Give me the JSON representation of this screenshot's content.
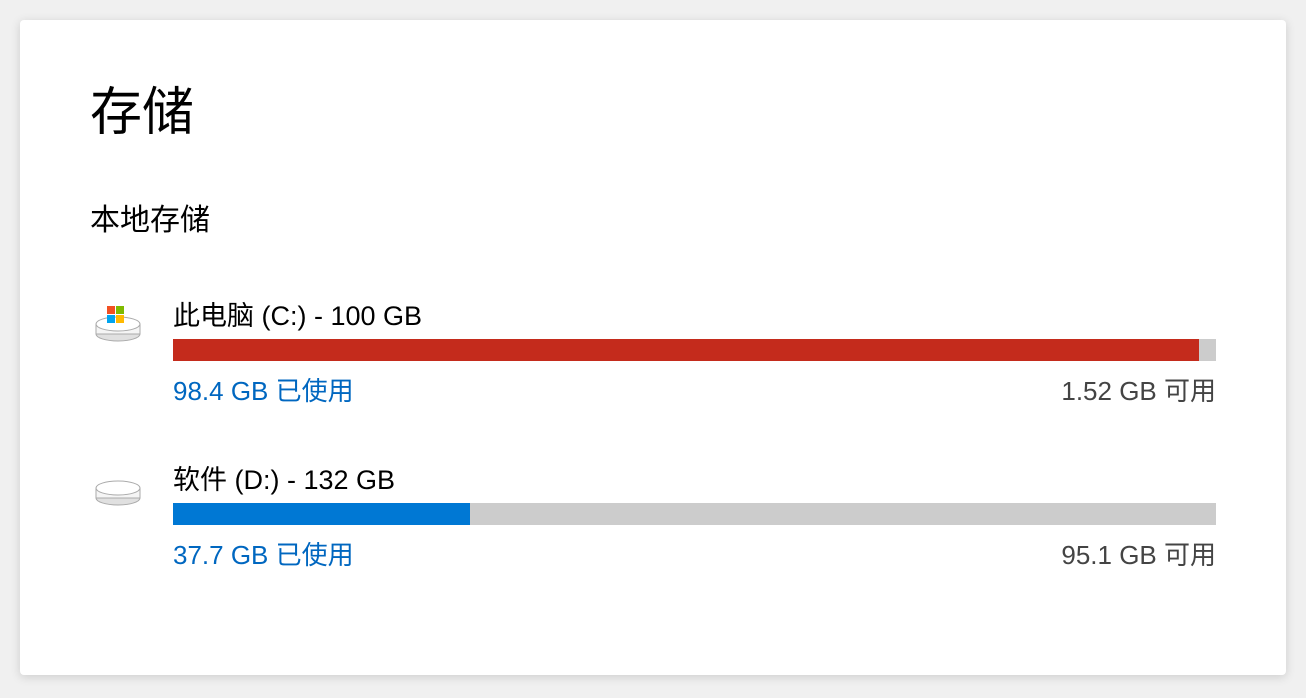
{
  "page_title": "存储",
  "section_title": "本地存储",
  "drives": [
    {
      "label": "此电脑 (C:) - 100 GB",
      "used_text": "98.4 GB 已使用",
      "free_text": "1.52 GB 可用",
      "fill_percent": 98.4,
      "fill_color": "red",
      "icon_type": "system"
    },
    {
      "label": "软件 (D:) - 132 GB",
      "used_text": "37.7 GB 已使用",
      "free_text": "95.1 GB 可用",
      "fill_percent": 28.5,
      "fill_color": "blue",
      "icon_type": "data"
    }
  ],
  "colors": {
    "red_fill": "#c42b1c",
    "blue_fill": "#0078d4",
    "link_blue": "#0067c0"
  }
}
